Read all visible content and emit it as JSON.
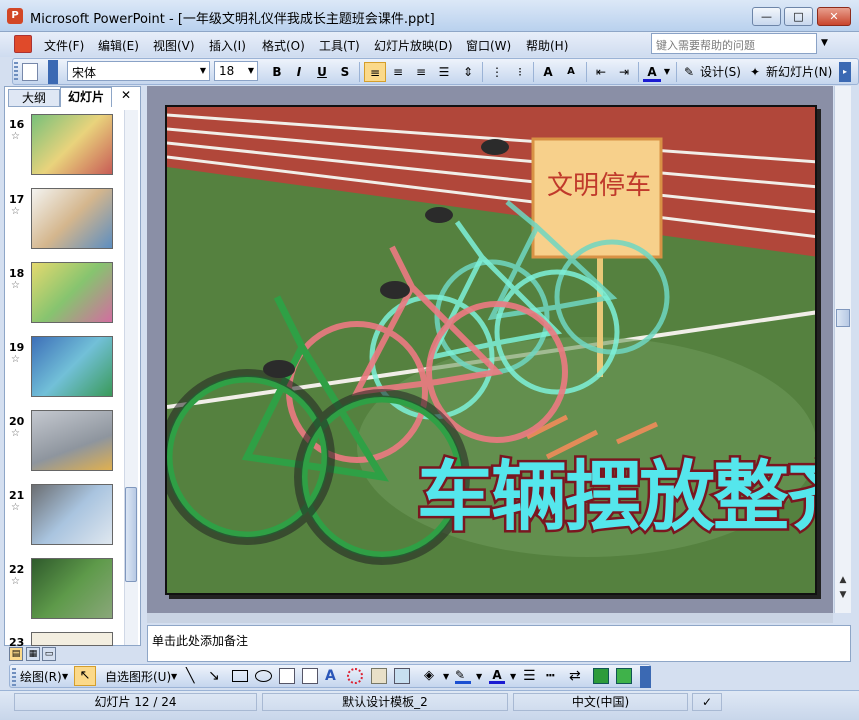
{
  "window": {
    "title": "Microsoft PowerPoint - [一年级文明礼仪伴我成长主题班会课件.ppt]",
    "app_icon": "P",
    "minimize_glyph": "—",
    "maximize_glyph": "□",
    "close_glyph": "✕"
  },
  "menu": {
    "items": [
      "文件(F)",
      "编辑(E)",
      "视图(V)",
      "插入(I)",
      "格式(O)",
      "工具(T)",
      "幻灯片放映(D)",
      "窗口(W)",
      "帮助(H)"
    ],
    "help_placeholder": "键入需要帮助的问题"
  },
  "toolbar": {
    "font": "宋体",
    "size": "18",
    "bold": "B",
    "italic": "I",
    "underline": "U",
    "shadow": "S",
    "grow_font": "A",
    "shrink_font": "A",
    "font_color_label": "A",
    "design_label": "设计(S)",
    "new_slide_label": "新幻灯片(N)"
  },
  "left_pane": {
    "tabs": [
      "大纲",
      "幻灯片"
    ],
    "close_glyph": "✕",
    "slides": [
      {
        "num": "16"
      },
      {
        "num": "17"
      },
      {
        "num": "18"
      },
      {
        "num": "19"
      },
      {
        "num": "20"
      },
      {
        "num": "21"
      },
      {
        "num": "22"
      },
      {
        "num": "23"
      }
    ],
    "star": "☆"
  },
  "slide": {
    "sign_text": "文明停车",
    "headline": "车辆摆放整齐"
  },
  "notes": {
    "placeholder": "单击此处添加备注"
  },
  "drawing_toolbar": {
    "draw_label": "绘图(R)",
    "autoshapes_label": "自选图形(U)"
  },
  "status": {
    "slide_info": "幻灯片 12 / 24",
    "template": "默认设计模板_2",
    "language": "中文(中国)"
  },
  "colors": {
    "headline_fill": "#55e6ec",
    "headline_outline": "#7a1620",
    "track_red": "#b34a3d",
    "field_green": "#4f7a3b"
  }
}
